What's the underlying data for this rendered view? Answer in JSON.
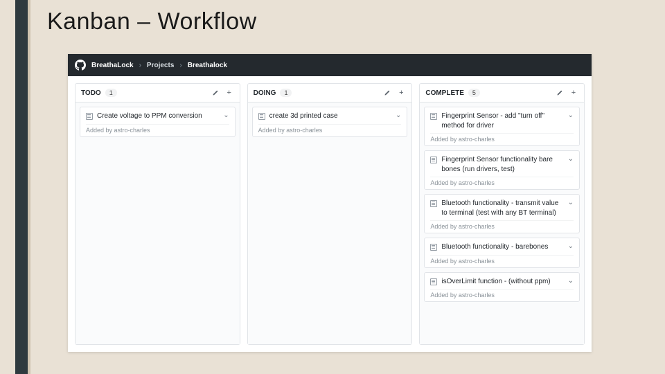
{
  "slide": {
    "title": "Kanban – Workflow"
  },
  "breadcrumb": {
    "org": "BreathaLock",
    "section": "Projects",
    "project": "Breathalock"
  },
  "labels": {
    "added_prefix": "Added by "
  },
  "columns": [
    {
      "title": "TODO",
      "count": "1",
      "cards": [
        {
          "title": "Create voltage to PPM conversion",
          "author": "astro-charles"
        }
      ]
    },
    {
      "title": "DOING",
      "count": "1",
      "cards": [
        {
          "title": "create 3d printed case",
          "author": "astro-charles"
        }
      ]
    },
    {
      "title": "COMPLETE",
      "count": "5",
      "cards": [
        {
          "title": "Fingerprint Sensor - add \"turn off\" method for driver",
          "author": "astro-charles"
        },
        {
          "title": "Fingerprint Sensor functionality bare bones (run drivers, test)",
          "author": "astro-charles"
        },
        {
          "title": "Bluetooth functionality - transmit value to terminal (test with any BT terminal)",
          "author": "astro-charles"
        },
        {
          "title": "Bluetooth functionality - barebones",
          "author": "astro-charles"
        },
        {
          "title": "isOverLimit function - (without ppm)",
          "author": "astro-charles"
        }
      ]
    }
  ]
}
